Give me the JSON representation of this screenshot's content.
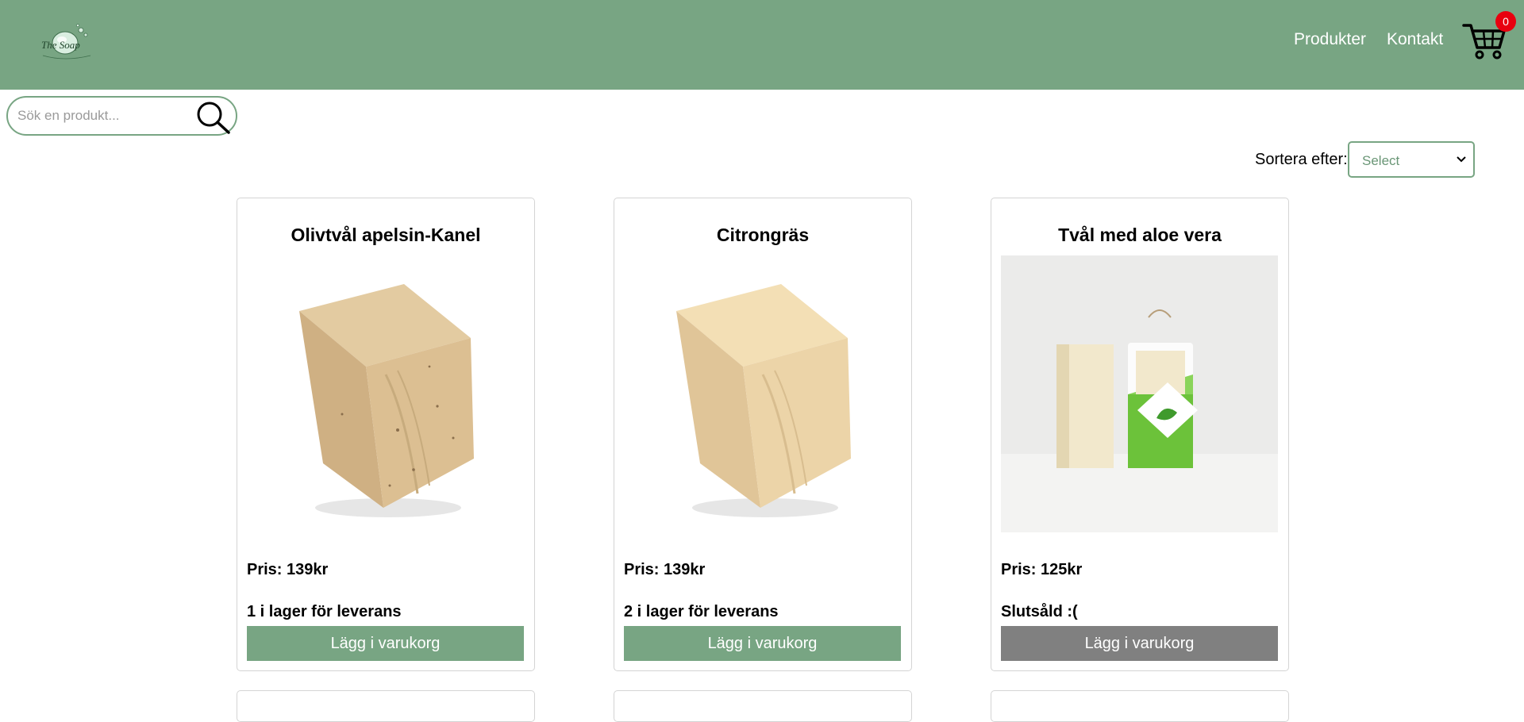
{
  "header": {
    "logo_text": "The Soap",
    "nav": {
      "products": "Produkter",
      "contact": "Kontakt"
    },
    "cart_count": "0"
  },
  "search": {
    "placeholder": "Sök en produkt...",
    "value": ""
  },
  "sort": {
    "label": "Sortera efter:",
    "selected": "Select"
  },
  "products": [
    {
      "title": "Olivtvål apelsin-Kanel",
      "price": "Pris: 139kr",
      "stock": "1 i lager för leverans",
      "button": "Lägg i varukorg",
      "available": true
    },
    {
      "title": "Citrongräs",
      "price": "Pris: 139kr",
      "stock": "2 i lager för leverans",
      "button": "Lägg i varukorg",
      "available": true
    },
    {
      "title": "Tvål med aloe vera",
      "price": "Pris: 125kr",
      "stock": "Slutsåld :(",
      "button": "Lägg i varukorg",
      "available": false
    }
  ],
  "colors": {
    "brand": "#78a583",
    "disabled": "#808080",
    "badge": "#e8000f"
  }
}
